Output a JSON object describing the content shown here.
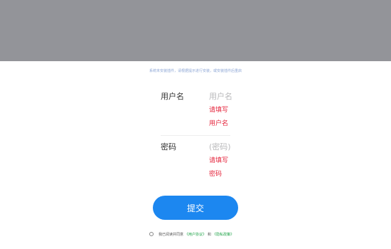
{
  "colors": {
    "banner": "#939499",
    "primary": "#1c87f0",
    "error": "#e5263d",
    "link": "#1fa348",
    "notice": "#8fa8d6"
  },
  "notice": "系统未安装插件，请根据提示进行安装，或安装插件后重启",
  "form": {
    "username": {
      "label": "用户名",
      "placeholder": "用户名",
      "value": "",
      "error_line1": "请填写",
      "error_line2": "用户名"
    },
    "password": {
      "label": "密码",
      "placeholder": "(密码)",
      "value": "",
      "error_line1": "请填写",
      "error_line2": "密码"
    },
    "submit_label": "提交"
  },
  "agreement": {
    "text": "我已阅读并同意",
    "link_terms": "《用户协议》",
    "and": "和",
    "link_privacy": "《隐私政策》"
  }
}
